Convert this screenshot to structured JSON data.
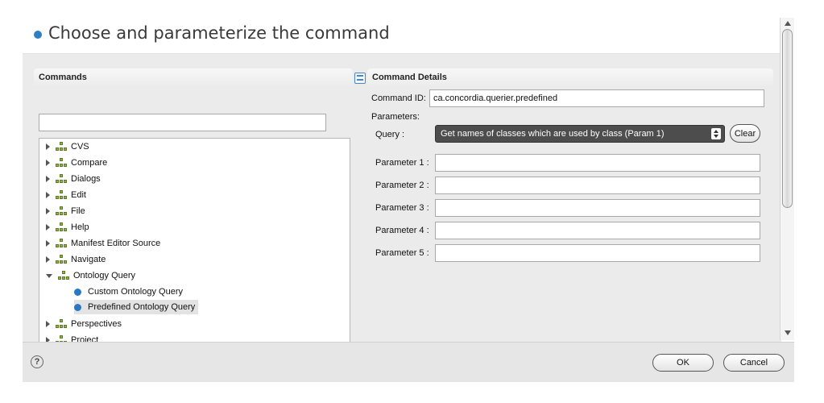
{
  "header": {
    "title": "Choose and parameterize the command"
  },
  "commands_panel": {
    "label": "Commands",
    "filter_value": "",
    "tree": [
      {
        "label": "CVS",
        "type": "category",
        "expanded": false
      },
      {
        "label": "Compare",
        "type": "category",
        "expanded": false
      },
      {
        "label": "Dialogs",
        "type": "category",
        "expanded": false
      },
      {
        "label": "Edit",
        "type": "category",
        "expanded": false
      },
      {
        "label": "File",
        "type": "category",
        "expanded": false
      },
      {
        "label": "Help",
        "type": "category",
        "expanded": false
      },
      {
        "label": "Manifest Editor Source",
        "type": "category",
        "expanded": false
      },
      {
        "label": "Navigate",
        "type": "category",
        "expanded": false
      },
      {
        "label": "Ontology Query",
        "type": "category",
        "expanded": true
      },
      {
        "label": "Custom Ontology Query",
        "type": "command"
      },
      {
        "label": "Predefined Ontology Query",
        "type": "command",
        "selected": true
      },
      {
        "label": "Perspectives",
        "type": "category",
        "expanded": false
      },
      {
        "label": "Project",
        "type": "category",
        "expanded": false
      }
    ]
  },
  "details_panel": {
    "label": "Command Details",
    "command_id_label": "Command ID:",
    "command_id_value": "ca.concordia.querier.predefined",
    "parameters_label": "Parameters:",
    "query_label": "Query :",
    "query_value": "Get names of classes which are used by class (Param 1)",
    "clear_label": "Clear",
    "params": [
      {
        "label": "Parameter 1 :",
        "value": ""
      },
      {
        "label": "Parameter 2 :",
        "value": ""
      },
      {
        "label": "Parameter 3 :",
        "value": ""
      },
      {
        "label": "Parameter 4 :",
        "value": ""
      },
      {
        "label": "Parameter 5 :",
        "value": ""
      }
    ]
  },
  "footer": {
    "help_glyph": "?",
    "ok_label": "OK",
    "cancel_label": "Cancel"
  },
  "colors": {
    "accent": "#2d7fc1",
    "panel_bg": "#ebebeb",
    "select_bg": "#4d4d4d"
  }
}
